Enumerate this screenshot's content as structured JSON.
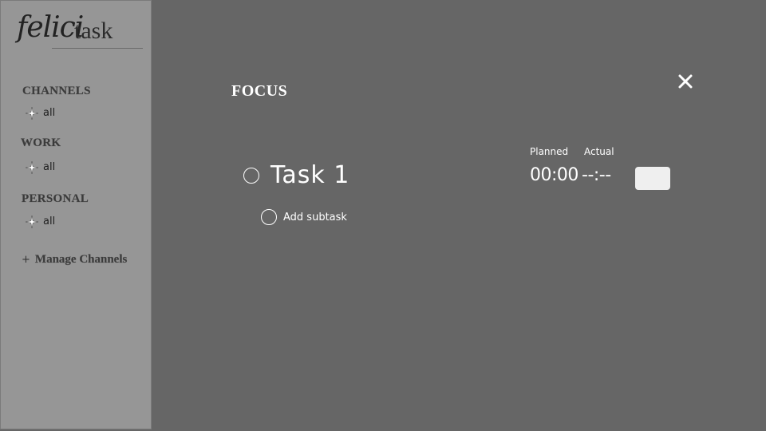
{
  "sidebar": {
    "logo": {
      "prefix": "felici",
      "suffix": "task"
    },
    "sections": [
      {
        "title": "CHANNELS",
        "items": [
          {
            "label": "all",
            "icon": "sparkle-icon"
          }
        ]
      },
      {
        "title": "WORK",
        "items": [
          {
            "label": "all",
            "icon": "sparkle-icon"
          }
        ]
      },
      {
        "title": "PERSONAL",
        "items": [
          {
            "label": "all",
            "icon": "sparkle-icon"
          }
        ]
      }
    ],
    "manage": {
      "plus": "+",
      "label": "Manage Channels"
    }
  },
  "main": {
    "title": "FOCUS",
    "close_icon": "close-icon",
    "task": {
      "name": "Task 1",
      "add_subtask_label": "Add subtask"
    },
    "time": {
      "planned_label": "Planned",
      "actual_label": "Actual",
      "planned_value": "00:00",
      "actual_value": "--:--"
    }
  },
  "colors": {
    "background": "#666666",
    "sidebar": "#969696",
    "text_main": "#ffffff",
    "input": "#efefef"
  }
}
